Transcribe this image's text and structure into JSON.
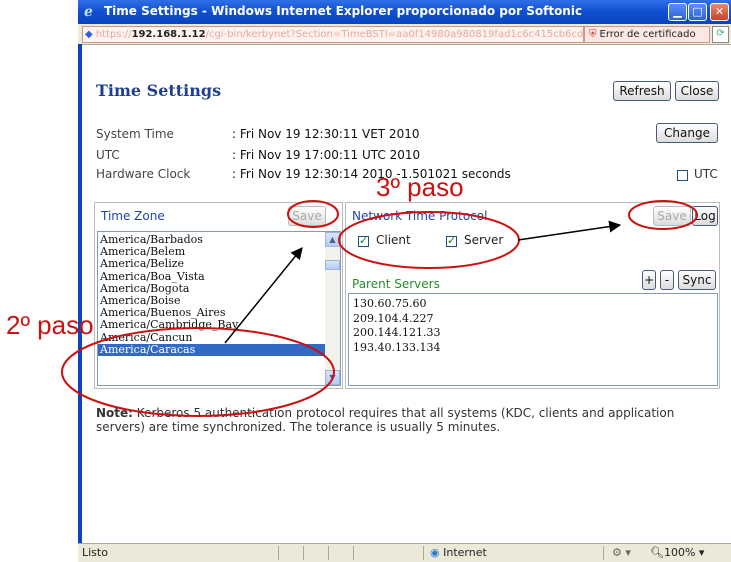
{
  "window": {
    "title": "Time Settings - Windows Internet Explorer proporcionado por Softonic",
    "address_prefix": "https://",
    "address_host": "192.168.1.12",
    "address_rest": "/cgi-bin/kerbynet?Section=TimeBSTI=aa0f14980a980819fad1c6c415cb6cdc",
    "cert_error": "Error de certificado"
  },
  "page": {
    "heading": "Time Settings",
    "refresh_label": "Refresh",
    "close_label": "Close",
    "change_label": "Change",
    "system_time_label": "System Time",
    "system_time_value": ": Fri Nov 19 12:30:11 VET 2010",
    "utc_label": "UTC",
    "utc_value": ": Fri Nov 19 17:00:11 UTC 2010",
    "hw_clock_label": "Hardware Clock",
    "hw_clock_value": ": Fri Nov 19 12:30:14 2010 -1.501021 seconds",
    "utc_checkbox_label": "UTC"
  },
  "timezone": {
    "title": "Time Zone",
    "save_label": "Save",
    "items": [
      "America/Barbados",
      "America/Belem",
      "America/Belize",
      "America/Boa_Vista",
      "America/Bogota",
      "America/Boise",
      "America/Buenos_Aires",
      "America/Cambridge_Bay",
      "America/Cancun",
      "America/Caracas"
    ],
    "selected": "America/Caracas"
  },
  "ntp": {
    "title": "Network Time Protocol",
    "save_label": "Save",
    "log_label": "Log",
    "client_label": "Client",
    "server_label": "Server",
    "client_checked": true,
    "server_checked": true,
    "parent_servers_label": "Parent Servers",
    "plus_label": "+",
    "minus_label": "-",
    "sync_label": "Sync",
    "servers": [
      "130.60.75.60",
      "209.104.4.227",
      "200.144.121.33",
      "193.40.133.134"
    ]
  },
  "note": {
    "bold": "Note:",
    "text": " Kerberos 5 authentication protocol requires that all systems (KDC, clients and application servers) are time synchronized. The tolerance is usually 5 minutes."
  },
  "status": {
    "left": "Listo",
    "zone": "Internet",
    "zoom": "100%"
  },
  "annotations": {
    "step2": "2º paso",
    "step3": "3º paso",
    "color": "#cc1111"
  }
}
